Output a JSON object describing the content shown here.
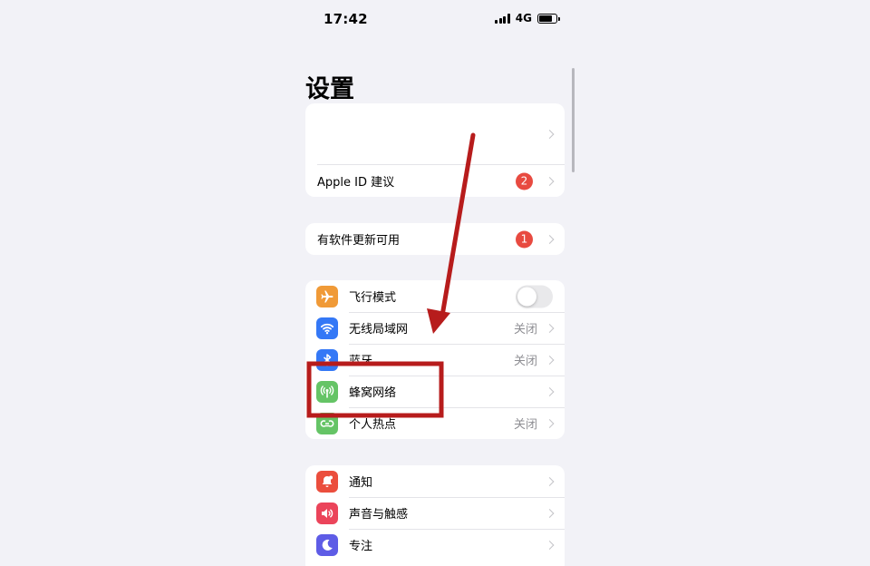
{
  "status": {
    "time": "17:42",
    "network": "4G",
    "battery_level": 0.8
  },
  "title": "设置",
  "account_group": {
    "apple_id_label": "Apple ID 建议",
    "apple_id_badge": "2"
  },
  "update_group": {
    "label": "有软件更新可用",
    "badge": "1"
  },
  "network_group": {
    "items": [
      {
        "label": "飞行模式",
        "icon": "airplane-icon",
        "color": "#f09a37",
        "toggle_on": false
      },
      {
        "label": "无线局域网",
        "icon": "wifi-icon",
        "color": "#3478f6",
        "value": "关闭"
      },
      {
        "label": "蓝牙",
        "icon": "bluetooth-icon",
        "color": "#3478f6",
        "value": "关闭"
      },
      {
        "label": "蜂窝网络",
        "icon": "antenna-icon",
        "color": "#65c466"
      },
      {
        "label": "个人热点",
        "icon": "hotspot-icon",
        "color": "#65c466",
        "value": "关闭"
      }
    ]
  },
  "notify_group": {
    "items": [
      {
        "label": "通知",
        "icon": "bell-icon",
        "color": "#eb4e3d"
      },
      {
        "label": "声音与触感",
        "icon": "speaker-icon",
        "color": "#eb445a"
      },
      {
        "label": "专注",
        "icon": "moon-icon",
        "color": "#5e5ce6"
      }
    ]
  },
  "annotation": {
    "color": "#b71c1c"
  }
}
